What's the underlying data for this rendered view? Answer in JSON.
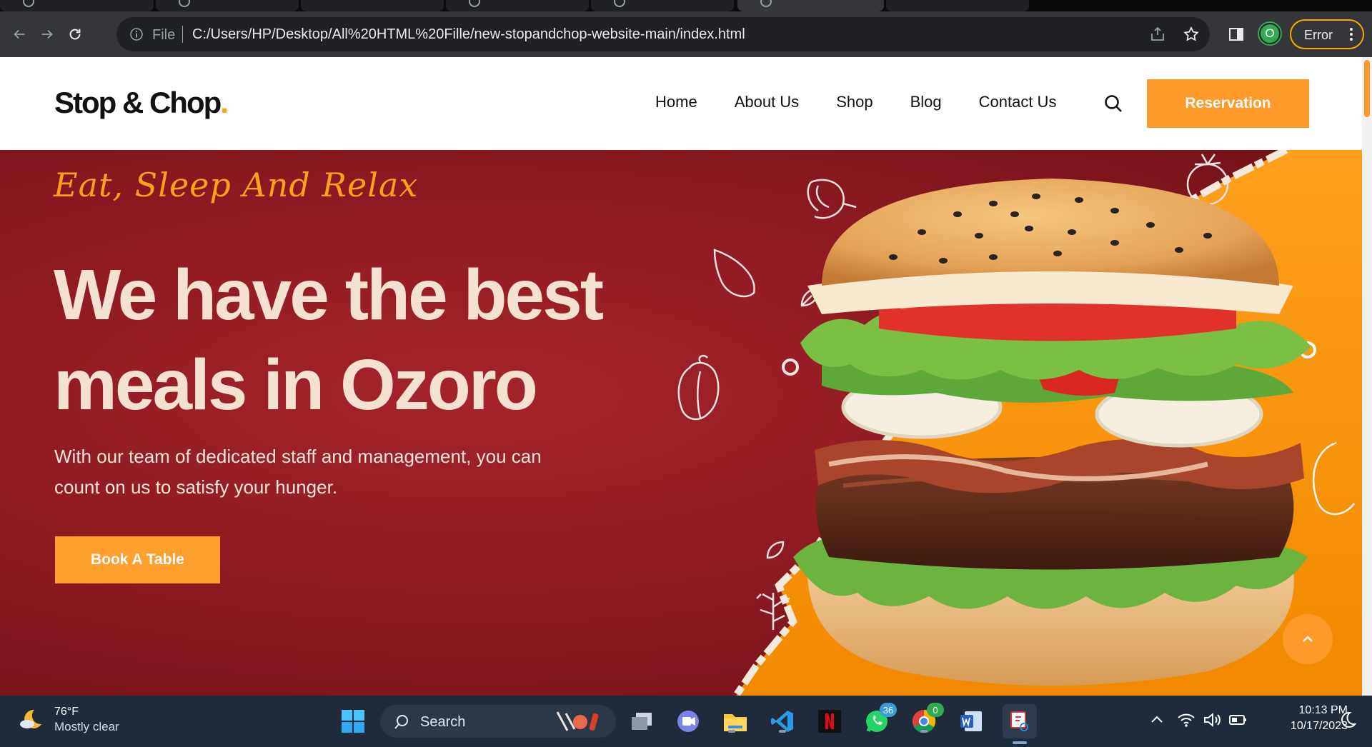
{
  "browser": {
    "file_label": "File",
    "url": "C:/Users/HP/Desktop/All%20HTML%20Fille/new-stopandchop-website-main/index.html",
    "profile_initial": "O",
    "error_label": "Error"
  },
  "site": {
    "logo": "Stop & Chop",
    "logo_dot": ".",
    "nav": [
      "Home",
      "About Us",
      "Shop",
      "Blog",
      "Contact Us"
    ],
    "reservation_label": "Reservation"
  },
  "hero": {
    "tagline": "Eat, Sleep And Relax",
    "headline_line1": "We have the best",
    "headline_line2": "meals in Ozoro",
    "description": "With our team of dedicated staff and management, you can count on us to satisfy your hunger.",
    "book_label": "Book A Table"
  },
  "taskbar": {
    "weather_temp": "76°F",
    "weather_condition": "Mostly clear",
    "search_label": "Search",
    "whatsapp_badge": "36",
    "chrome_badge": "0",
    "time": "10:13 PM",
    "date": "10/17/2023"
  },
  "colors": {
    "brand_orange": "#ff9a2a",
    "hero_red": "#8e1a22",
    "headline_cream": "#f4e1d2"
  }
}
